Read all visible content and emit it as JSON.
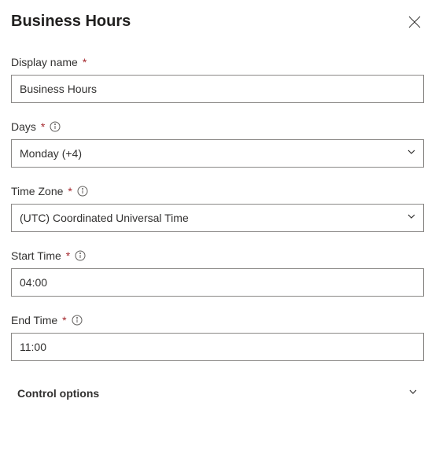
{
  "panel": {
    "title": "Business Hours"
  },
  "fields": {
    "displayName": {
      "label": "Display name",
      "value": "Business Hours"
    },
    "days": {
      "label": "Days",
      "value": "Monday (+4)"
    },
    "timeZone": {
      "label": "Time Zone",
      "value": "(UTC) Coordinated Universal Time"
    },
    "startTime": {
      "label": "Start Time",
      "value": "04:00"
    },
    "endTime": {
      "label": "End Time",
      "value": "11:00"
    }
  },
  "controlOptions": {
    "label": "Control options"
  }
}
